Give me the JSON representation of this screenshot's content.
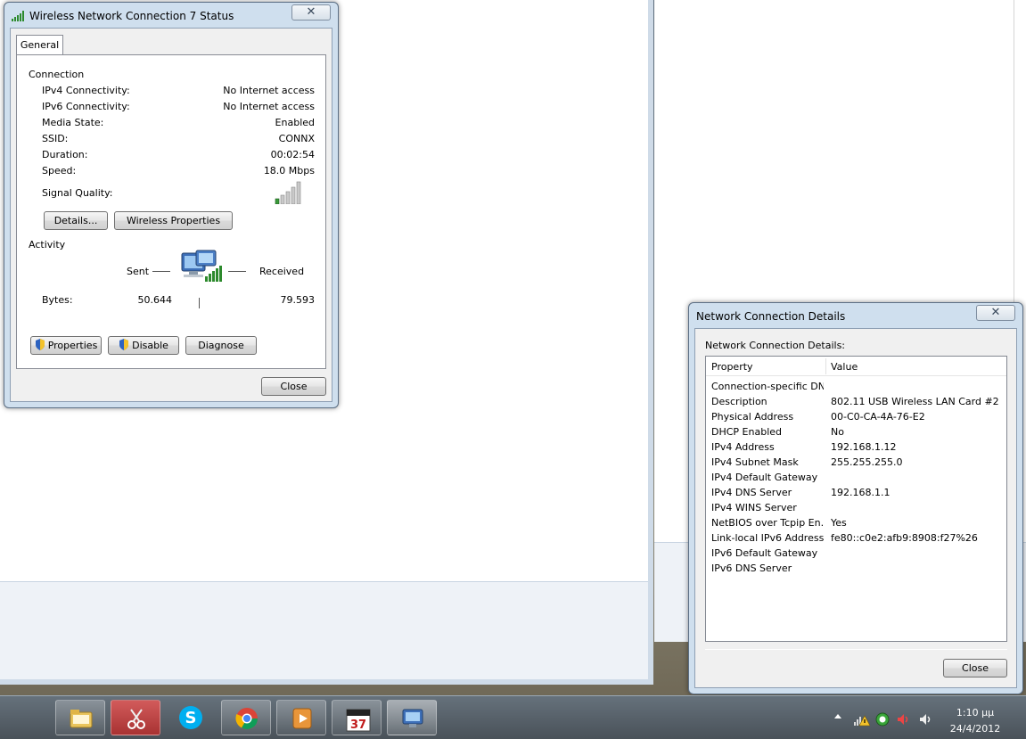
{
  "status_dialog": {
    "title": "Wireless Network Connection 7 Status",
    "close_x": "✕",
    "tab_general": "General",
    "connection_header": "Connection",
    "rows": [
      {
        "label": "IPv4 Connectivity:",
        "value": "No Internet access"
      },
      {
        "label": "IPv6 Connectivity:",
        "value": "No Internet access"
      },
      {
        "label": "Media State:",
        "value": "Enabled"
      },
      {
        "label": "SSID:",
        "value": "CONNX"
      },
      {
        "label": "Duration:",
        "value": "00:02:54"
      },
      {
        "label": "Speed:",
        "value": "18.0 Mbps"
      }
    ],
    "signal_quality_label": "Signal Quality:",
    "details_button": "Details...",
    "wireless_properties_button": "Wireless Properties",
    "activity_header": "Activity",
    "sent_label": "Sent",
    "received_label": "Received",
    "bytes_label": "Bytes:",
    "bytes_sent": "50.644",
    "bytes_received": "79.593",
    "properties_button": "Properties",
    "disable_button": "Disable",
    "diagnose_button": "Diagnose",
    "close_button": "Close"
  },
  "details_dialog": {
    "title": "Network Connection Details",
    "close_x": "✕",
    "section_label": "Network Connection Details:",
    "col_property": "Property",
    "col_value": "Value",
    "rows": [
      {
        "property": "Connection-specific DN...",
        "value": ""
      },
      {
        "property": "Description",
        "value": "802.11 USB Wireless LAN Card #2"
      },
      {
        "property": "Physical Address",
        "value": "00-C0-CA-4A-76-E2"
      },
      {
        "property": "DHCP Enabled",
        "value": "No"
      },
      {
        "property": "IPv4 Address",
        "value": "192.168.1.12"
      },
      {
        "property": "IPv4 Subnet Mask",
        "value": "255.255.255.0"
      },
      {
        "property": "IPv4 Default Gateway",
        "value": ""
      },
      {
        "property": "IPv4 DNS Server",
        "value": "192.168.1.1"
      },
      {
        "property": "IPv4 WINS Server",
        "value": ""
      },
      {
        "property": "NetBIOS over Tcpip En...",
        "value": "Yes"
      },
      {
        "property": "Link-local IPv6 Address",
        "value": "fe80::c0e2:afb9:8908:f27%26"
      },
      {
        "property": "IPv6 Default Gateway",
        "value": ""
      },
      {
        "property": "IPv6 DNS Server",
        "value": ""
      }
    ],
    "close_button": "Close"
  },
  "taskbar": {
    "time": "1:10 μμ",
    "date": "24/4/2012",
    "calendar_day": "37"
  }
}
